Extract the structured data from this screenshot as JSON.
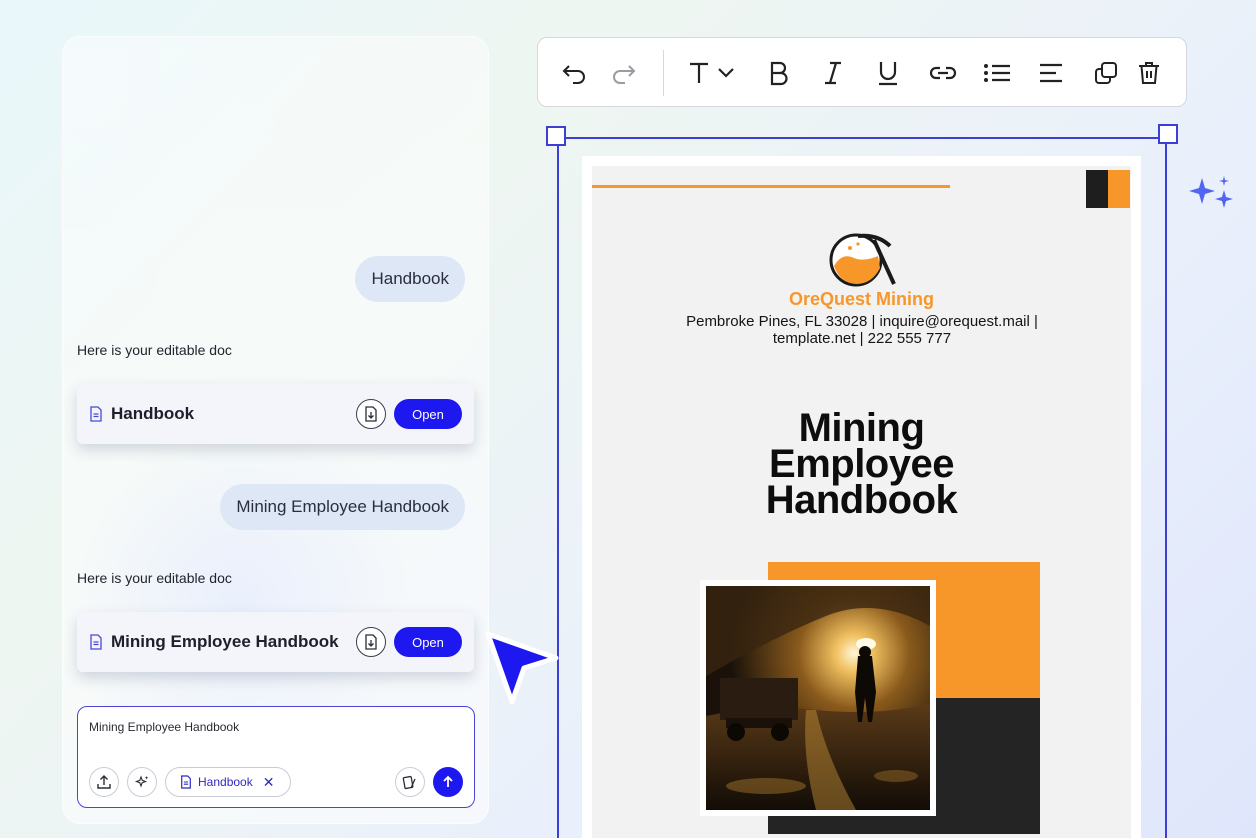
{
  "chat": {
    "messages": [
      {
        "role": "user",
        "text": "Handbook"
      },
      {
        "role": "assistant",
        "text": "Here is your editable doc",
        "doc_title": "Handbook",
        "open_label": "Open"
      },
      {
        "role": "user",
        "text": "Mining Employee Handbook"
      },
      {
        "role": "assistant",
        "text": "Here is your editable doc",
        "doc_title": "Mining Employee Handbook",
        "open_label": "Open"
      }
    ],
    "composer": {
      "value": "Mining Employee Handbook",
      "chip_label": "Handbook"
    }
  },
  "toolbar": {
    "tools": [
      "undo-icon",
      "redo-icon",
      "text-style-icon",
      "bold-icon",
      "italic-icon",
      "underline-icon",
      "link-icon",
      "bullet-list-icon",
      "align-left-icon",
      "duplicate-icon",
      "delete-icon"
    ]
  },
  "document": {
    "company": "OreQuest Mining",
    "address_line1": "Pembroke Pines, FL 33028 | inquire@orequest.mail |",
    "address_line2": "template.net | 222 555 777",
    "title_line1": "Mining",
    "title_line2": "Employee",
    "title_line3": "Handbook"
  },
  "colors": {
    "accent": "#1d17f0",
    "selection": "#3b3fd6",
    "brand_orange": "#f7972a",
    "dark_block": "#242424"
  }
}
